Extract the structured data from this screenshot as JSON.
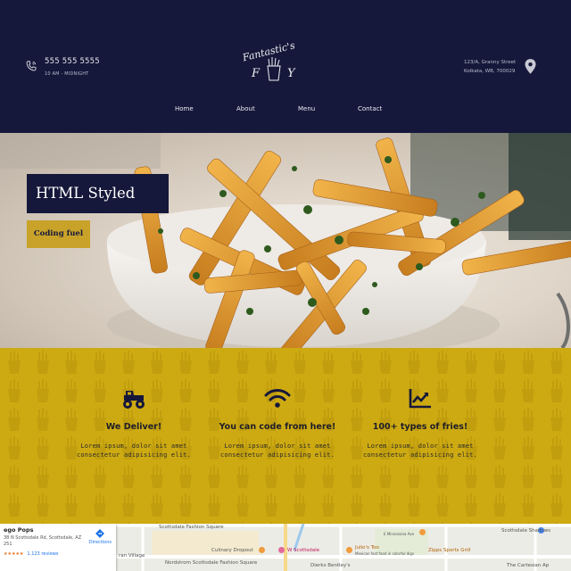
{
  "header": {
    "phone": "555 555 5555",
    "hours": "10 AM - MIDNIGHT",
    "address_line1": "123/A, Granny Street",
    "address_line2": "Kolkata, WB, 700029",
    "logo_top": "Fantastic's",
    "logo_left": "F",
    "logo_right": "Y"
  },
  "nav": {
    "items": [
      "Home",
      "About",
      "Menu",
      "Contact"
    ]
  },
  "hero": {
    "title": "HTML Styled Fries",
    "button_label": "Coding fuel"
  },
  "features": [
    {
      "icon": "monster-truck-icon",
      "title": "We Deliver!",
      "text": "Lorem ipsum, dolor sit amet consectetur adipisicing elit."
    },
    {
      "icon": "wifi-icon",
      "title": "You can code from here!",
      "text": "Lorem ipsum, dolor sit amet consectetur adipisicing elit."
    },
    {
      "icon": "trending-chart-icon",
      "title": "100+ types of fries!",
      "text": "Lorem ipsum, dolor sit amet consectetur adipisicing elit."
    }
  ],
  "map": {
    "place_name": "ego Pops",
    "place_address": "38 N Scottsdale Rd, Scottsdale, AZ 251",
    "rating_stars": "★★★★★",
    "reviews": "1,123 reviews",
    "directions_label": "Directions",
    "labels": [
      "Scottsdale Fashion Square",
      "Culinary Dropout",
      "Nordstrom Scottsdale Fashion Square",
      "W Scottsdale",
      "Julio's Too",
      "Mexican fast food in colorful digs",
      "Zipps Sports Grill",
      "Scottsdale Shadows",
      "Dierks Bentley's",
      "The Cartesian Ap",
      "E Minnezona Ave",
      "ran Village"
    ]
  },
  "colors": {
    "navy": "#15183a",
    "gold": "#ceaa12",
    "button_gold": "#c9a22a"
  }
}
